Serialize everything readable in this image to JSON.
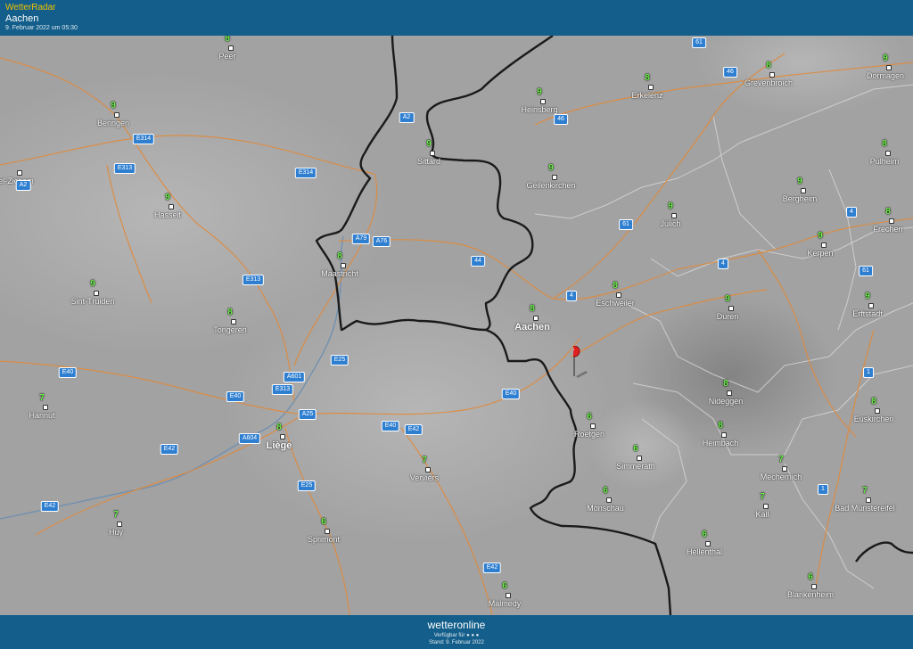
{
  "header": {
    "app_name": "WetterRadar",
    "location": "Aachen",
    "timestamp": "9. Februar 2022 um 05:30"
  },
  "footer": {
    "brand": "wetteronline",
    "availability": "Verfügbar für",
    "stand": "Stand: 9. Februar 2022"
  },
  "colors": {
    "header_bg": "#135e8a",
    "accent_title": "#f2c300",
    "temperature": "#6df24a",
    "road": "#e08a3c",
    "border": "#1a1a1a",
    "highway_shield": "#2f7fd1",
    "pin": "#e02020"
  },
  "map": {
    "marker": "map-pin-icon",
    "cities": [
      {
        "name": "Peer",
        "temp": "8"
      },
      {
        "name": "Beringen",
        "temp": "9"
      },
      {
        "name": "Hasselt",
        "temp": "9"
      },
      {
        "name": "el-Zichem",
        "temp": ""
      },
      {
        "name": "Sint-Truiden",
        "temp": "9"
      },
      {
        "name": "Tongeren",
        "temp": "8"
      },
      {
        "name": "Maastricht",
        "temp": "8"
      },
      {
        "name": "Sittard",
        "temp": "9"
      },
      {
        "name": "Heinsberg",
        "temp": "9"
      },
      {
        "name": "Erkelenz",
        "temp": "8"
      },
      {
        "name": "Grevenbroich",
        "temp": "8"
      },
      {
        "name": "Dormagen",
        "temp": "9"
      },
      {
        "name": "Geilenkirchen",
        "temp": "9"
      },
      {
        "name": "Jülich",
        "temp": "9"
      },
      {
        "name": "Bergheim",
        "temp": "9"
      },
      {
        "name": "Pulheim",
        "temp": "8"
      },
      {
        "name": "Frechen",
        "temp": "8"
      },
      {
        "name": "Kerpen",
        "temp": "9"
      },
      {
        "name": "Aachen",
        "temp": "8"
      },
      {
        "name": "Eschweiler",
        "temp": "8"
      },
      {
        "name": "Düren",
        "temp": "9"
      },
      {
        "name": "Erftstadt",
        "temp": "9"
      },
      {
        "name": "Hannut",
        "temp": "7"
      },
      {
        "name": "Liège",
        "temp": "8"
      },
      {
        "name": "Roetgen",
        "temp": "6"
      },
      {
        "name": "Nideggen",
        "temp": "8"
      },
      {
        "name": "Euskirchen",
        "temp": "8"
      },
      {
        "name": "Heimbach",
        "temp": "8"
      },
      {
        "name": "Simmerath",
        "temp": "6"
      },
      {
        "name": "Verviers",
        "temp": "7"
      },
      {
        "name": "Mechernich",
        "temp": "7"
      },
      {
        "name": "Huy",
        "temp": "7"
      },
      {
        "name": "Monschau",
        "temp": "6"
      },
      {
        "name": "Kall",
        "temp": "7"
      },
      {
        "name": "Bad Münstereifel",
        "temp": "7"
      },
      {
        "name": "Sprimont",
        "temp": "6"
      },
      {
        "name": "Hellenthal",
        "temp": "6"
      },
      {
        "name": "Blankenheim",
        "temp": "6"
      },
      {
        "name": "Malmedy",
        "temp": "6"
      }
    ],
    "roads": [
      "61",
      "46",
      "46",
      "A2",
      "E314",
      "E313",
      "E314",
      "A2",
      "A79",
      "A76",
      "44",
      "61",
      "4",
      "4",
      "E313",
      "4",
      "61",
      "A601",
      "E25",
      "E313",
      "E40",
      "E40",
      "1",
      "E40",
      "A25",
      "E40",
      "E42",
      "A604",
      "E42",
      "E25",
      "1",
      "E42",
      "E42"
    ]
  }
}
